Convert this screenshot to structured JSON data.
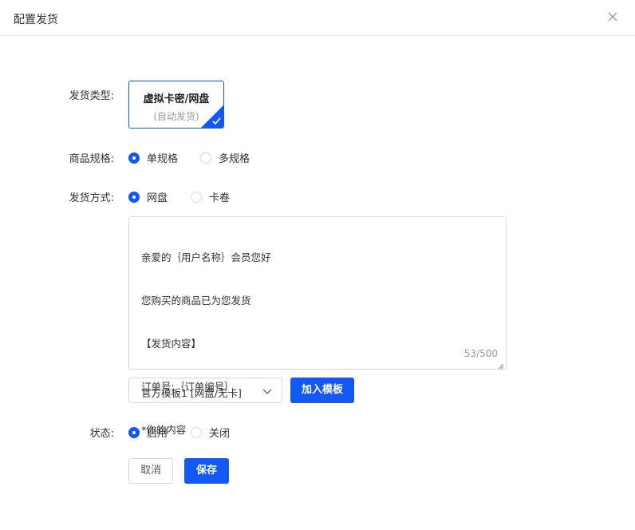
{
  "dialog": {
    "title": "配置发货"
  },
  "form": {
    "delivery_type": {
      "label": "发货类型:",
      "card_title": "虚拟卡密/网盘",
      "card_subtitle": "(自动发货)"
    },
    "spec": {
      "label": "商品规格:",
      "options": [
        {
          "label": "单规格",
          "checked": true
        },
        {
          "label": "多规格",
          "checked": false
        }
      ]
    },
    "method": {
      "label": "发货方式:",
      "options": [
        {
          "label": "网盘",
          "checked": true
        },
        {
          "label": "卡卷",
          "checked": false
        }
      ]
    },
    "content": {
      "lines": [
        "亲爱的｛用户名称｝会员您好",
        "您购买的商品已为您发货",
        "【发货内容】",
        "订单号:｛订单编号｝",
        "*你的内容"
      ],
      "counter": "53/500"
    },
    "template": {
      "selected": "官方模板1 [网盘/无卡]",
      "add_button": "加入模板"
    },
    "status": {
      "label": "状态:",
      "options": [
        {
          "label": "启用",
          "checked": true
        },
        {
          "label": "关闭",
          "checked": false
        }
      ]
    }
  },
  "actions": {
    "cancel": "取消",
    "save": "保存"
  },
  "colors": {
    "primary": "#1158f5",
    "border": "#d9d9d9",
    "muted": "#999999"
  }
}
